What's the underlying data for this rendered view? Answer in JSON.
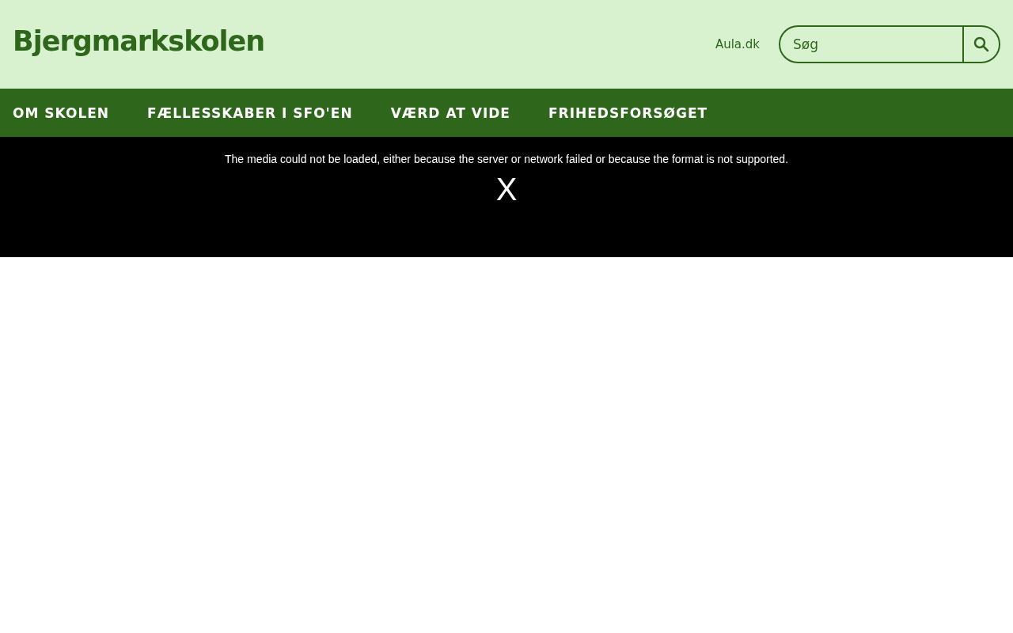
{
  "header": {
    "logo": "Bjergmarkskolen",
    "link": "Aula.dk",
    "search": {
      "placeholder": "Søg"
    }
  },
  "nav": [
    "OM SKOLEN",
    "FÆLLESSKABER I SFO'EN",
    "VÆRD AT VIDE",
    "FRIHEDSFORSØGET"
  ],
  "media": {
    "error": "The media could not be loaded, either because the server or network failed or because the format is not supported.",
    "close": "X"
  }
}
